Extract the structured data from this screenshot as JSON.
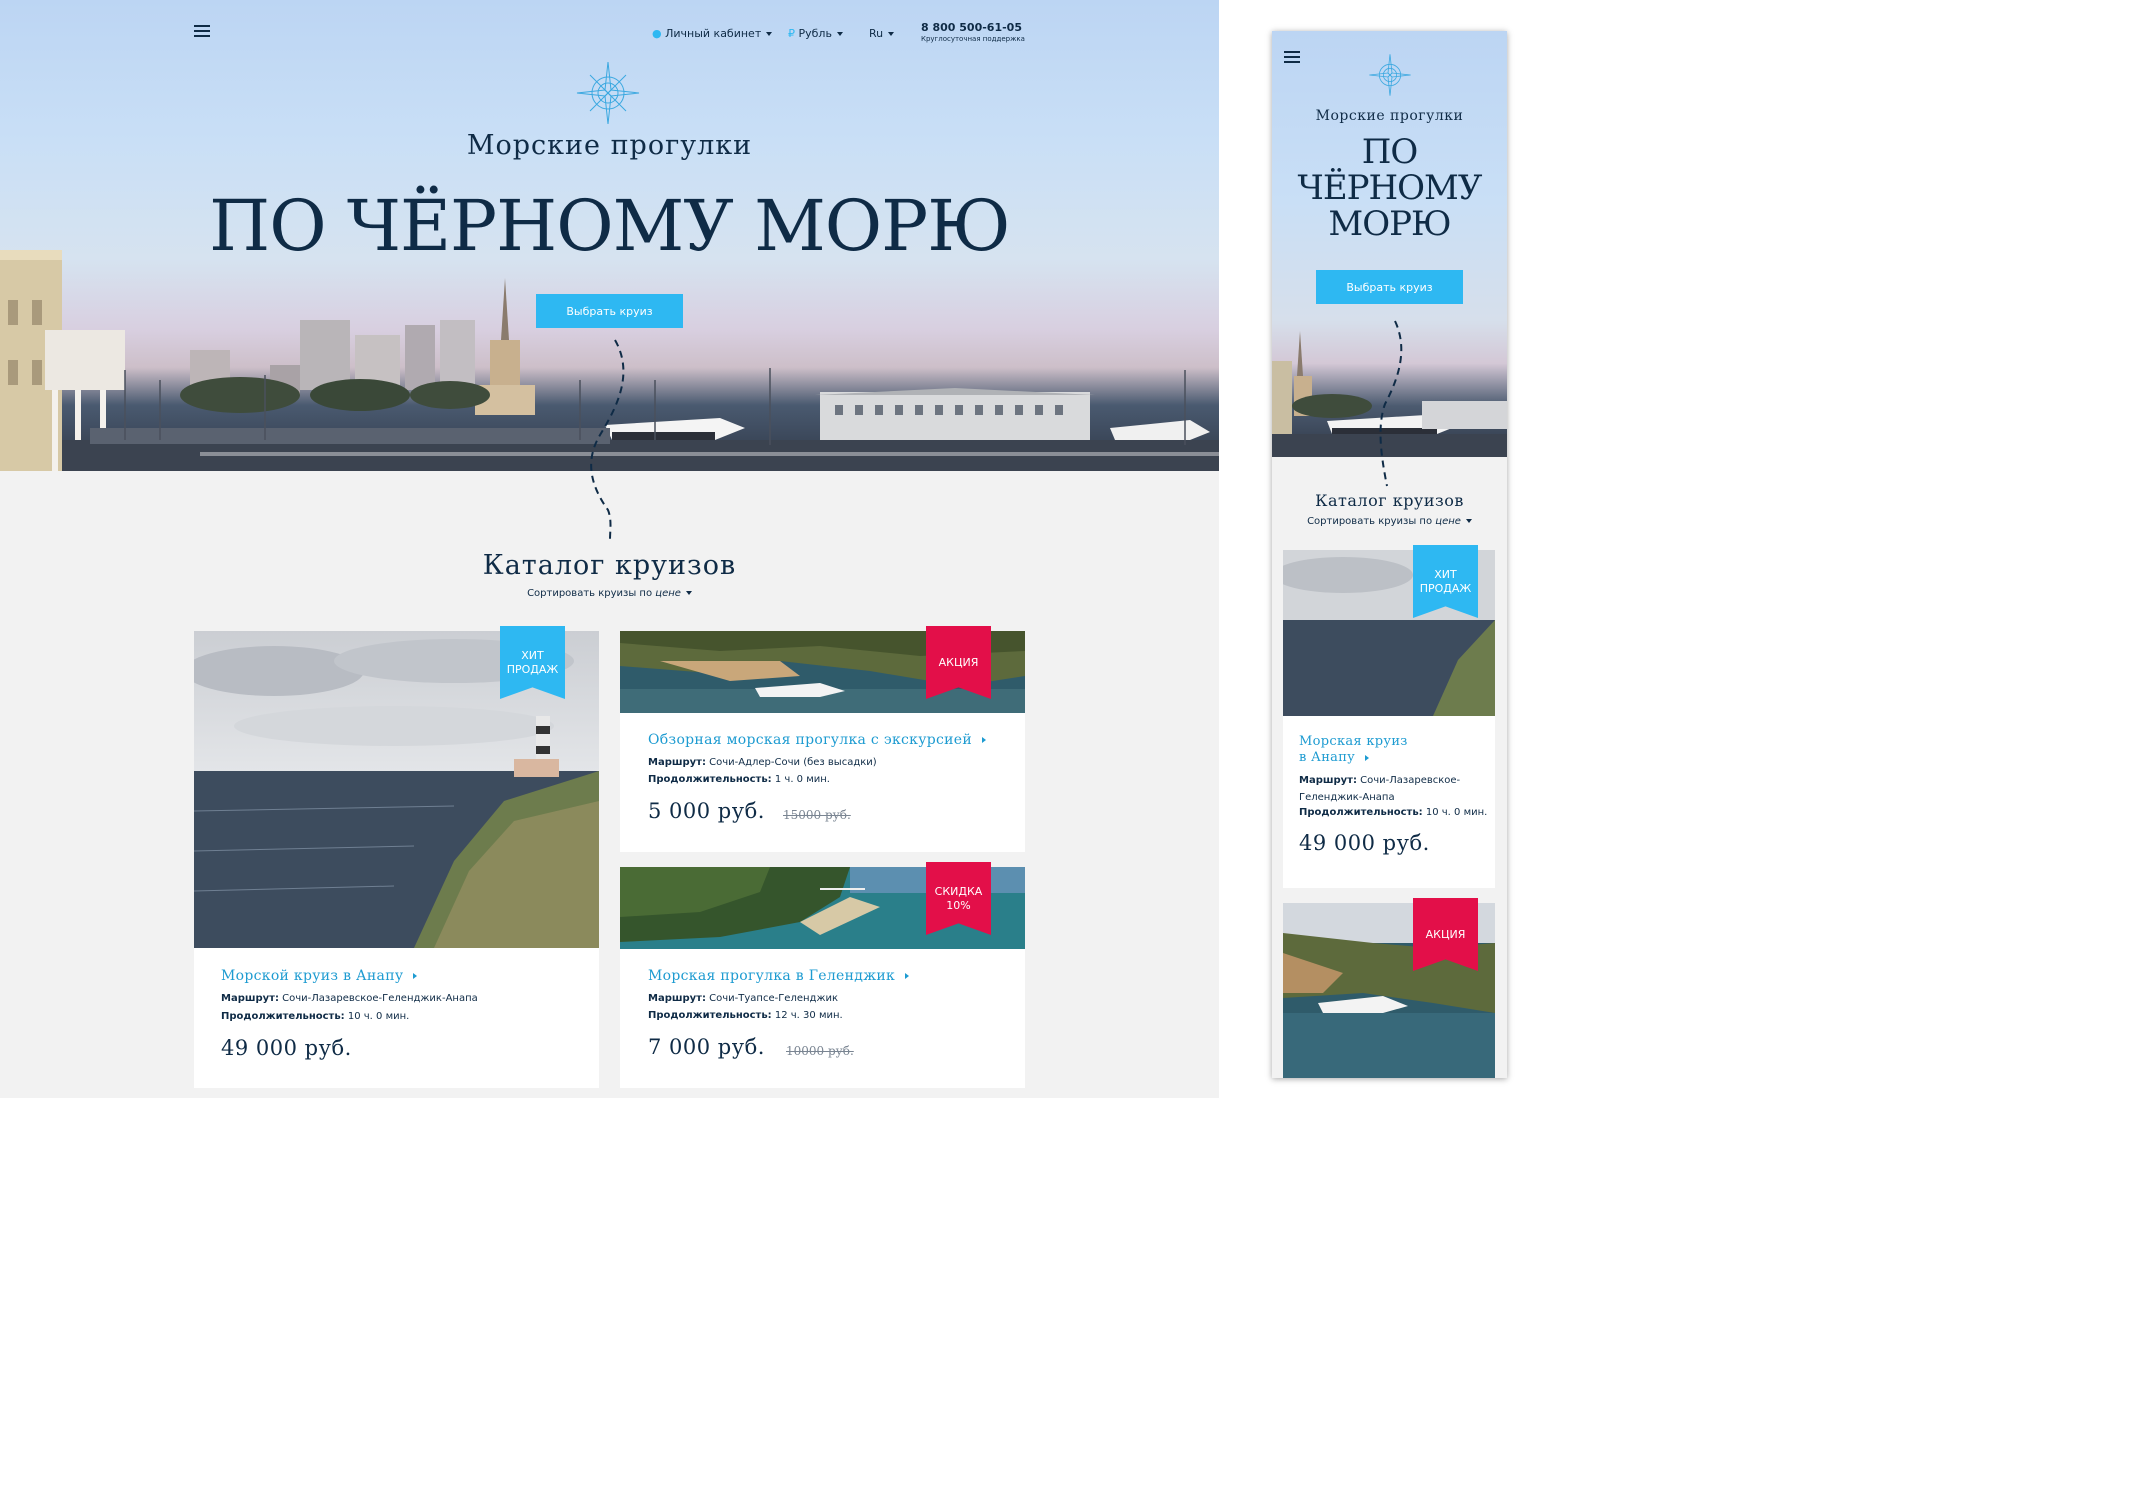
{
  "header": {
    "account_label": "Личный кабинет",
    "currency_label": "Рубль",
    "currency_symbol": "₽",
    "lang_label": "Ru",
    "phone": "8 800 500-61-05",
    "support_label": "Круглосуточная поддержка"
  },
  "hero": {
    "subtitle": "Морские прогулки",
    "title": "ПО ЧЁРНОМУ МОРЮ",
    "title_mobile": [
      "ПО",
      "ЧЁРНОМУ",
      "МОРЮ"
    ],
    "cta": "Выбрать круиз"
  },
  "catalog": {
    "title": "Каталог круизов",
    "sort_prefix": "Сортировать круизы по",
    "sort_value": "цене"
  },
  "cruises": [
    {
      "title": "Морской круиз в Анапу",
      "title_mobile": [
        "Морская круиз",
        "в Анапу"
      ],
      "route_label": "Маршрут:",
      "route": "Сочи-Лазаревское-Геленджик-Анапа",
      "route_mobile": [
        "Сочи-Лазаревское-",
        "Геленджик-Анапа"
      ],
      "duration_label": "Продолжительность:",
      "duration": "10 ч. 0 мин.",
      "price": "49 000 руб.",
      "badge": [
        "ХИТ",
        "ПРОДАЖ"
      ]
    },
    {
      "title": "Обзорная морская прогулка с экскурсией",
      "route_label": "Маршрут:",
      "route": "Сочи-Адлер-Сочи (без высадки)",
      "duration_label": "Продолжительность:",
      "duration": "1 ч. 0 мин.",
      "price": "5 000 руб.",
      "old_price": "15000 руб.",
      "badge": [
        "АКЦИЯ"
      ]
    },
    {
      "title": "Морская прогулка в Геленджик",
      "route_label": "Маршрут:",
      "route": "Сочи-Туапсе-Геленджик",
      "duration_label": "Продолжительность:",
      "duration": "12 ч. 30 мин.",
      "price": "7 000 руб.",
      "old_price": "10000 руб.",
      "badge": [
        "СКИДКА",
        "10%"
      ]
    }
  ],
  "colors": {
    "accent": "#2eb8f2",
    "sale": "#e30f49",
    "navy": "#0f2b46",
    "link": "#1d9bd1"
  }
}
